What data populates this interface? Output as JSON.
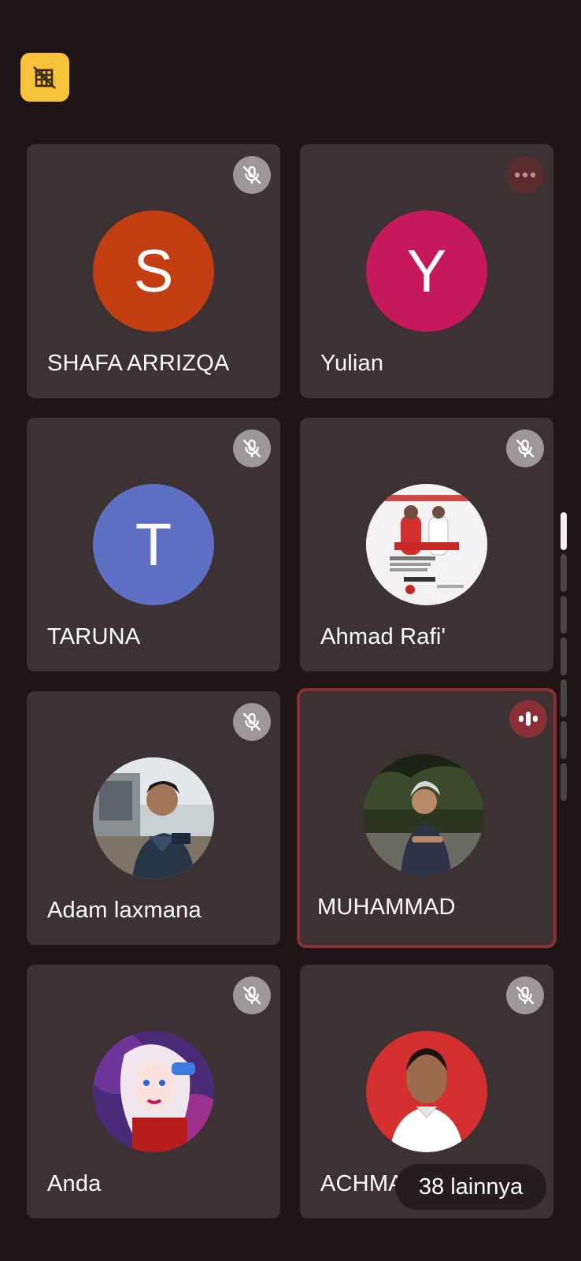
{
  "top_badge": {
    "icon": "no-video-grid-icon",
    "color": "#f6c33b"
  },
  "tiles": [
    {
      "name": "SHAFA ARRIZQA",
      "initial": "S",
      "avatar_color": "#c23d11",
      "status": "muted"
    },
    {
      "name": "Yulian",
      "initial": "Y",
      "avatar_color": "#c6195b",
      "status": "more"
    },
    {
      "name": "TARUNA",
      "initial": "T",
      "avatar_color": "#5f6fc3",
      "status": "muted"
    },
    {
      "name": "Ahmad Rafi'",
      "status": "muted",
      "photo": "poster"
    },
    {
      "name": "Adam laxmana",
      "status": "muted",
      "photo": "person-outdoor"
    },
    {
      "name": "MUHAMMAD",
      "status": "speaking",
      "photo": "person-nature"
    },
    {
      "name": "Anda",
      "status": "muted",
      "photo": "cartoon"
    },
    {
      "name": "ACHMA",
      "status": "muted",
      "photo": "portrait-red"
    }
  ],
  "more_participants_label": "38 lainnya",
  "colors": {
    "tile_bg": "#3c3233",
    "page_bg": "#1f1516",
    "speaking_border": "#8b2f34"
  }
}
